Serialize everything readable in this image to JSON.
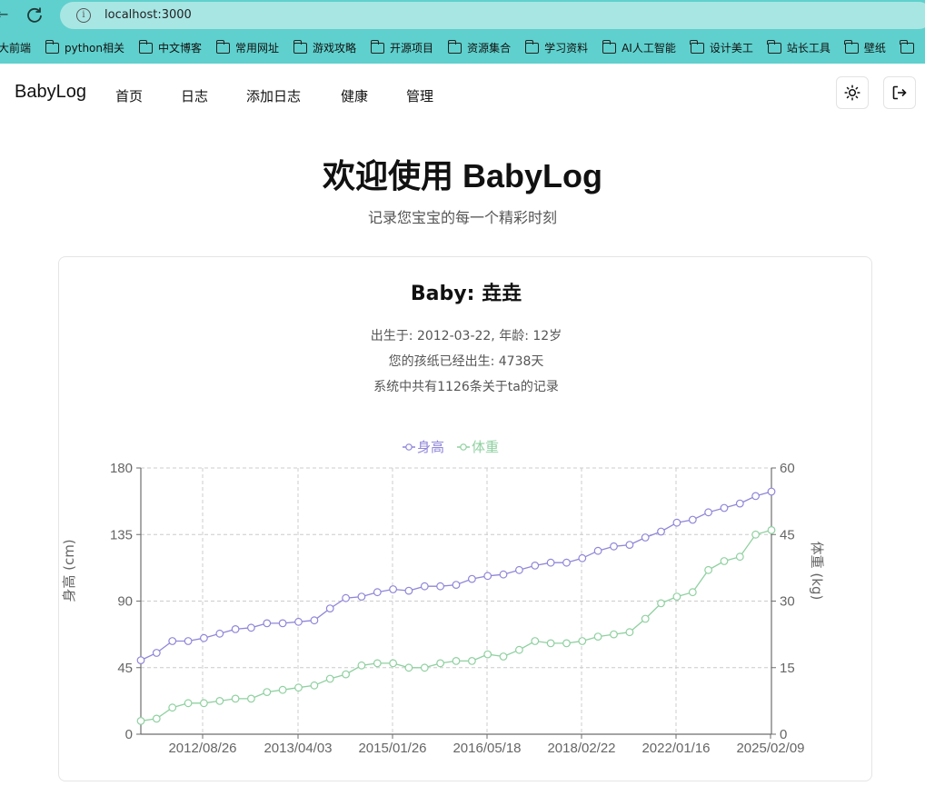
{
  "browser": {
    "url": "localhost:3000",
    "bookmarks": [
      "大前端",
      "python相关",
      "中文博客",
      "常用网址",
      "游戏攻略",
      "开源项目",
      "资源集合",
      "学习资料",
      "AI人工智能",
      "设计美工",
      "站长工具",
      "壁纸"
    ]
  },
  "app": {
    "brand": "BabyLog",
    "nav": [
      "首页",
      "日志",
      "添加日志",
      "健康",
      "管理"
    ],
    "theme_icon": "sun-icon",
    "logout_icon": "logout-icon"
  },
  "hero": {
    "title": "欢迎使用 BabyLog",
    "subtitle": "记录您宝宝的每一个精彩时刻"
  },
  "baby": {
    "name": "Baby: 垚垚",
    "birth_line": "出生于: 2012-03-22, 年龄: 12岁",
    "days_line": "您的孩纸已经出生: 4738天",
    "records_line": "系统中共有1126条关于ta的记录"
  },
  "colors": {
    "height_series": "#8f86d8",
    "weight_series": "#8fd0a0",
    "grid": "#cccccc",
    "axis": "#6e6e6e"
  },
  "chart_data": {
    "type": "line",
    "grid": true,
    "legend_position": "top-center",
    "x_ticks": [
      "2012/08/26",
      "2013/04/03",
      "2015/01/26",
      "2016/05/18",
      "2018/02/22",
      "2022/01/16",
      "2025/02/09"
    ],
    "y_left": {
      "label": "身高 (cm)",
      "ticks": [
        "0",
        "45",
        "90",
        "135",
        "180"
      ],
      "range": [
        0,
        180
      ]
    },
    "y_right": {
      "label": "体重 (kg)",
      "ticks": [
        "0",
        "15",
        "30",
        "45",
        "60"
      ],
      "range": [
        0,
        60
      ]
    },
    "series": [
      {
        "name": "身高",
        "axis": "left",
        "values": [
          50,
          55,
          63,
          63,
          65,
          68,
          71,
          72,
          75,
          75,
          76,
          77,
          85,
          92,
          93,
          96,
          98,
          97,
          100,
          100,
          101,
          105,
          107,
          108,
          111,
          114,
          116,
          116,
          119,
          124,
          127,
          128,
          133,
          137,
          143,
          145,
          150,
          153,
          156,
          161,
          164
        ]
      },
      {
        "name": "体重",
        "axis": "right",
        "values": [
          3,
          3.5,
          6,
          7,
          7,
          7.5,
          8,
          8,
          9.5,
          10,
          10.5,
          11,
          12.5,
          13.5,
          15.5,
          16,
          16,
          15,
          15,
          16,
          16.5,
          16.5,
          18,
          17.5,
          19,
          21,
          20.5,
          20.5,
          21,
          22,
          22.5,
          23,
          26,
          29.5,
          31,
          32,
          37,
          39,
          40,
          45,
          46
        ]
      }
    ]
  }
}
